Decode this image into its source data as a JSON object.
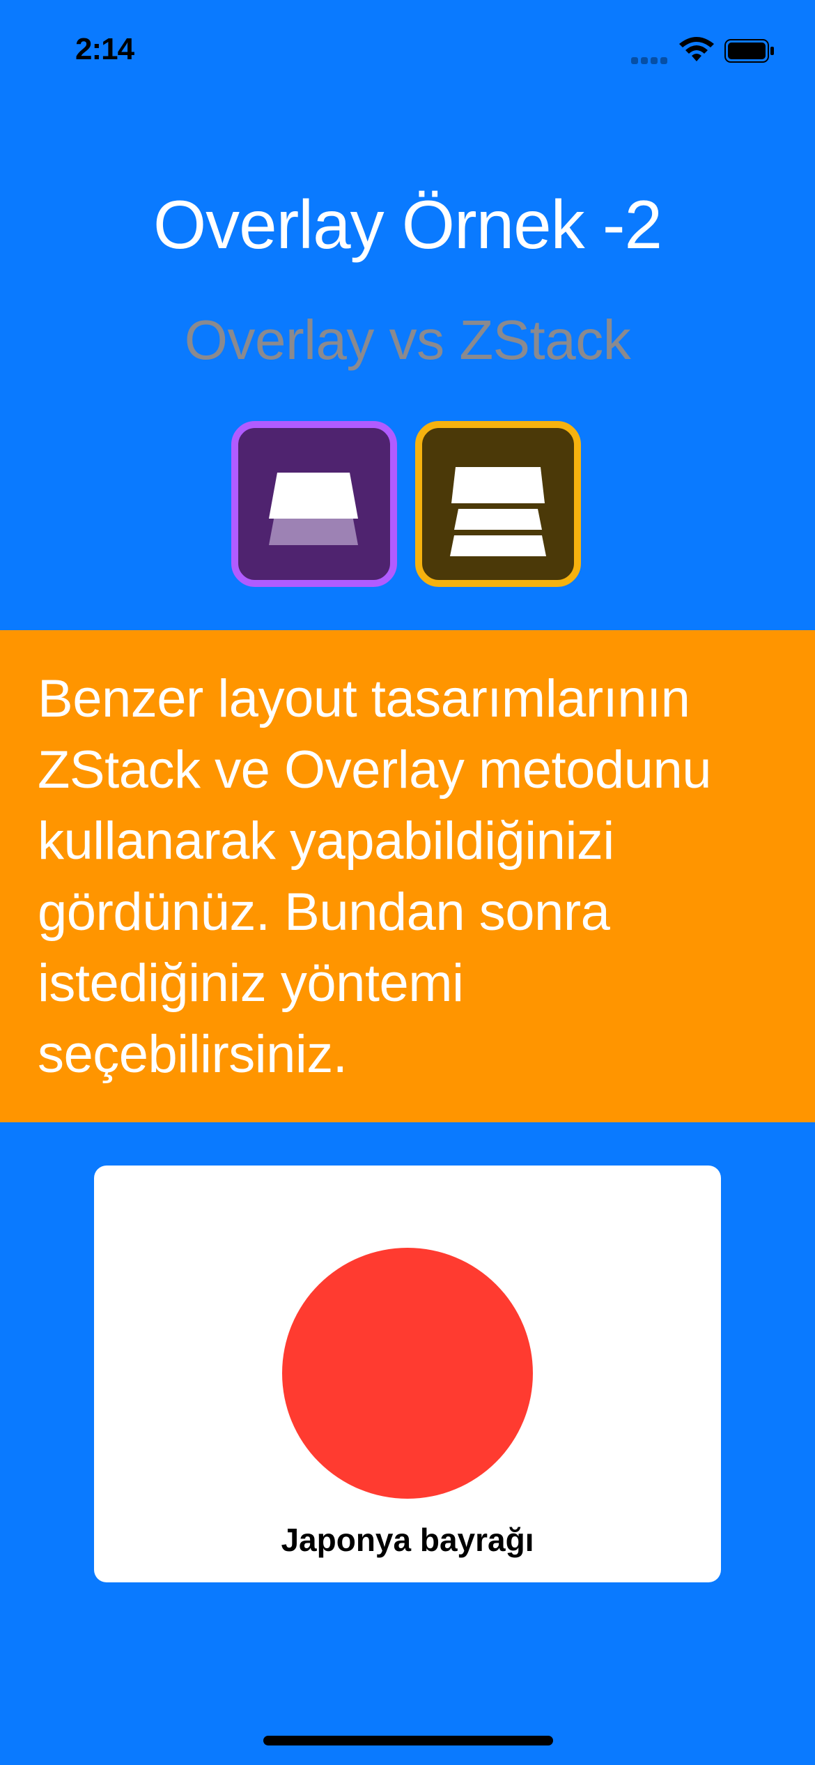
{
  "status_bar": {
    "time": "2:14",
    "icons": [
      "cellular-signal-icon",
      "wifi-icon",
      "battery-icon"
    ]
  },
  "header": {
    "title": "Overlay Örnek -2",
    "subtitle": "Overlay vs ZStack"
  },
  "icons": [
    {
      "name": "overlay-layers-icon",
      "accent": "#b15cff",
      "fill": "#4f236f"
    },
    {
      "name": "zstack-layers-icon",
      "accent": "#f6b20f",
      "fill": "#4b3908"
    }
  ],
  "info": {
    "text": "Benzer layout tasarımlarının ZStack ve Overlay metodunu kullanarak yapabildiğinizi gördünüz. Bundan sonra istediğiniz yöntemi seçebilirsiniz."
  },
  "flag": {
    "caption": "Japonya bayrağı",
    "colors": {
      "background": "#ffffff",
      "circle": "#ff3b30"
    }
  },
  "colors": {
    "screen_background": "#0a7aff",
    "banner_background": "#ff9500",
    "title_text": "#ffffff",
    "subtitle_text": "#8a8a8f"
  }
}
